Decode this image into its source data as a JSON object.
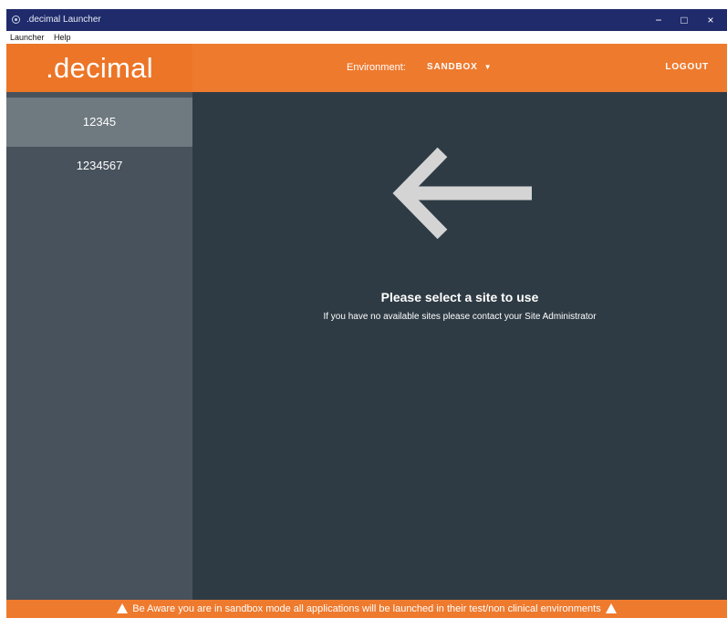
{
  "window": {
    "title": ".decimal Launcher",
    "controls": {
      "minimize": "−",
      "maximize": "□",
      "close": "×"
    }
  },
  "menu": [
    "Launcher",
    "Help"
  ],
  "header": {
    "logo": ".decimal",
    "environment_label": "Environment:",
    "environment_value": "SANDBOX",
    "logout": "LOGOUT"
  },
  "sites": [
    {
      "label": "12345",
      "selected": true
    },
    {
      "label": "1234567",
      "selected": false
    }
  ],
  "main": {
    "heading": "Please select a site to use",
    "subtext": "If you have no available sites please contact your Site Administrator",
    "arrow_icon": "arrow-left-icon"
  },
  "banner": {
    "text": "Be Aware you are in sandbox mode all applications will be launched in their test/non clinical environments",
    "icon": "warning-icon"
  },
  "colors": {
    "accent": "#ee7a2e",
    "titlebar": "#1f2b6b",
    "sidebar": "#48525c",
    "sidebar_selected": "#6f7980",
    "content": "#2e3b44",
    "arrow": "#d4d4d4"
  }
}
